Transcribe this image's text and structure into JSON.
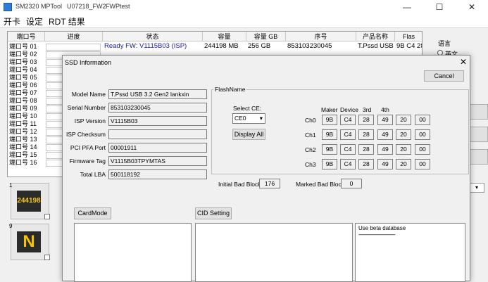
{
  "window": {
    "title_parts": [
      "SM2320 MPTool",
      "U07218_FW2",
      "FWPtest"
    ],
    "controls": {
      "minimize": "—",
      "maximize": "☐",
      "close": "✕"
    }
  },
  "menu": [
    "开卡",
    "设定",
    "RDT 结果"
  ],
  "table": {
    "headers": [
      "端口号",
      "进度",
      "状态",
      "容量",
      "容量 GB",
      "序号",
      "产品名称",
      "Flas"
    ],
    "row1": {
      "status": "Ready FW: V1115B03 (ISP)",
      "capacity": "244198 MB",
      "capacity_gb": "256 GB",
      "serial": "853103230045",
      "product": "T.Pssd USB 3",
      "flash": "9B C4 28"
    },
    "ports": [
      "端口号 01",
      "端口号 02",
      "端口号 03",
      "端口号 04",
      "端口号 05",
      "端口号 06",
      "端口号 07",
      "端口号 08",
      "端口号 09",
      "端口号 10",
      "端口号 11",
      "端口号 12",
      "端口号 13",
      "端口号 14",
      "端口号 15",
      "端口号 16"
    ]
  },
  "right_panel": {
    "lang_label": "语言",
    "lang_option": "英文"
  },
  "tiles": [
    {
      "num": "1",
      "text": "244198",
      "text_color": "#f5c400"
    },
    {
      "num": "9",
      "text": "N",
      "text_color": "#f5c400"
    }
  ],
  "dialog": {
    "title": "SSD Information",
    "cancel": "Cancel",
    "fields": [
      {
        "label": "Model Name",
        "value": "T.Pssd USB 3.2 Gen2 lankxin"
      },
      {
        "label": "Serial Number",
        "value": "853103230045"
      },
      {
        "label": "ISP Version",
        "value": "V1115B03"
      },
      {
        "label": "ISP Checksum",
        "value": ""
      },
      {
        "label": "PCI PFA Port",
        "value": "00001911"
      },
      {
        "label": "Firmware Tag",
        "value": "V1115B03TPYMTAS"
      },
      {
        "label": "Total LBA",
        "value": "500118192"
      }
    ],
    "flash": {
      "group_title": "FlashName",
      "select_ce_label": "Select CE:",
      "select_ce_value": "CE0",
      "display_all": "Display All",
      "col_headers": [
        "Maker",
        "Device",
        "3rd",
        "4th"
      ],
      "rows": [
        {
          "ch": "Ch0",
          "vals": [
            "9B",
            "C4",
            "28",
            "49",
            "20",
            "00"
          ]
        },
        {
          "ch": "Ch1",
          "vals": [
            "9B",
            "C4",
            "28",
            "49",
            "20",
            "00"
          ]
        },
        {
          "ch": "Ch2",
          "vals": [
            "9B",
            "C4",
            "28",
            "49",
            "20",
            "00"
          ]
        },
        {
          "ch": "Ch3",
          "vals": [
            "9B",
            "C4",
            "28",
            "49",
            "20",
            "00"
          ]
        }
      ]
    },
    "initial_bad_label": "Initial Bad Block",
    "initial_bad_value": "176",
    "marked_bad_label": "Marked Bad Block",
    "marked_bad_value": "0",
    "cardmode": "CardMode",
    "cid_setting": "CID Setting",
    "db_text_line1": "Use beta database",
    "db_text_line2": "-------------------------------"
  }
}
